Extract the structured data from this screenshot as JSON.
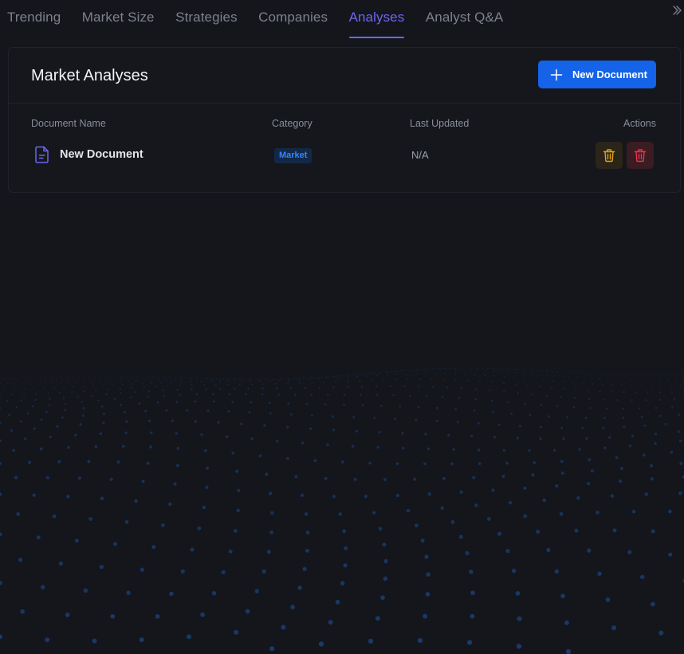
{
  "tabs": [
    {
      "label": "Trending",
      "active": false
    },
    {
      "label": "Market Size",
      "active": false
    },
    {
      "label": "Strategies",
      "active": false
    },
    {
      "label": "Companies",
      "active": false
    },
    {
      "label": "Analyses",
      "active": true
    },
    {
      "label": "Analyst Q&A",
      "active": false
    }
  ],
  "colors": {
    "background": "#14161c",
    "accent": "#6d66f2",
    "primary_button": "#1463e8",
    "edit_action": "#e0a818",
    "delete_action": "#e5364f"
  },
  "card": {
    "title": "Market Analyses",
    "new_button_label": "New Document",
    "new_button_icon": "plus-icon"
  },
  "table": {
    "headers": {
      "name": "Document Name",
      "category": "Category",
      "updated": "Last Updated",
      "actions": "Actions"
    },
    "rows": [
      {
        "icon": "document-icon",
        "name": "New Document",
        "category": "Market",
        "last_updated": "N/A",
        "actions": [
          "trash-icon",
          "trash-icon"
        ]
      }
    ]
  },
  "toggle_icon": "double-chevron-right-icon"
}
